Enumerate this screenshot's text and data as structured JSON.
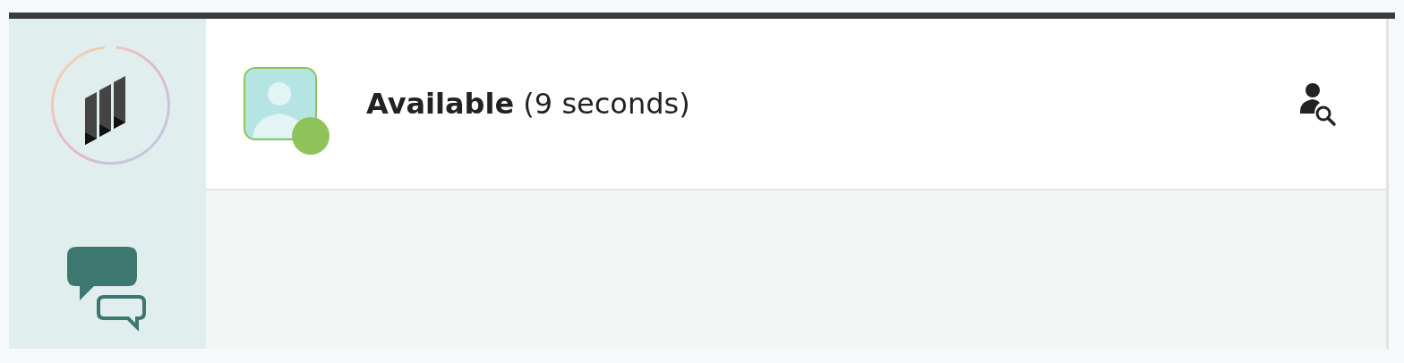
{
  "agent": {
    "status": "Available",
    "duration": "(9 seconds)",
    "online": true
  }
}
